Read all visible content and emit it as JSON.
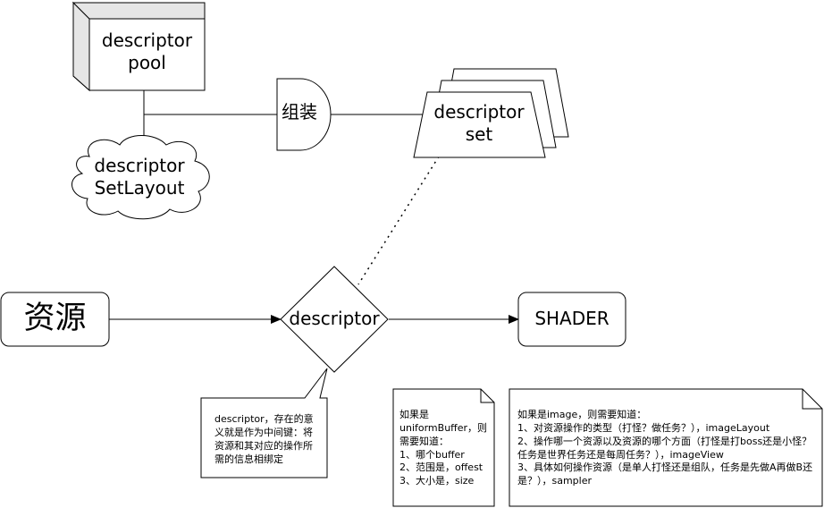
{
  "nodes": {
    "pool": "descriptor\npool",
    "set_layout": "descriptor\nSetLayout",
    "assemble": "组装",
    "set": "descriptor\nset",
    "resource": "资源",
    "descriptor": "descriptor",
    "shader": "SHADER"
  },
  "notes": {
    "descriptor_callout": "descriptor，存在的意义就是作为中间键：将资源和其对应的操作所需的信息相绑定",
    "uniform_buffer": "如果是uniformBuffer，则需要知道：\n1、哪个buffer\n2、范围是，offest\n3、大小是，size",
    "image": "如果是image，则需要知道：\n1、对资源操作的类型（打怪？做任务？），imageLayout\n2、操作哪一个资源以及资源的哪个方面（打怪是打boss还是小怪？任务是世界任务还是每周任务？），imageView\n3、具体如何操作资源（是单人打怪还是组队，任务是先做A再做B还是？），sampler"
  }
}
